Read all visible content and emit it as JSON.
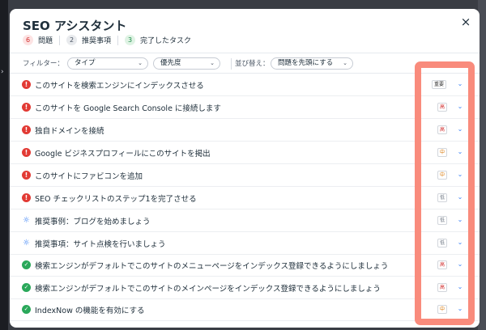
{
  "modal": {
    "title": "SEO アシスタント",
    "close_icon": "×",
    "stats": [
      {
        "count": "6",
        "label": "問題",
        "color": "#d12d2d"
      },
      {
        "count": "2",
        "label": "推奨事項",
        "color": "#4a5563"
      },
      {
        "count": "3",
        "label": "完了したタスク",
        "color": "#1e8c4a"
      }
    ]
  },
  "filters": {
    "filter_label": "フィルター：",
    "type_value": "タイプ",
    "priority_value": "優先度",
    "sort_label": "並び替え：",
    "sort_value": "問題を先頭にする"
  },
  "tasks": [
    {
      "status": "issue",
      "text": "このサイトを検索エンジンにインデックスさせる",
      "priority": "重要"
    },
    {
      "status": "issue",
      "text": "このサイトを Google Search Console に接続します",
      "priority": "高"
    },
    {
      "status": "issue",
      "text": "独自ドメインを接続",
      "priority": "高"
    },
    {
      "status": "issue",
      "text": "Google ビジネスプロフィールにこのサイトを掲出",
      "priority": "中"
    },
    {
      "status": "issue",
      "text": "このサイトにファビコンを追加",
      "priority": "中"
    },
    {
      "status": "issue",
      "text": "SEO チェックリストのステップ1を完了させる",
      "priority": "低"
    },
    {
      "status": "tip",
      "text": "推奨事例：ブログを始めましょう",
      "priority": "低"
    },
    {
      "status": "tip",
      "text": "推奨事項：サイト点検を行いましょう",
      "priority": "低"
    },
    {
      "status": "done",
      "text": "検索エンジンがデフォルトでこのサイトのメニューページをインデックス登録できるようにしましょう",
      "priority": "高"
    },
    {
      "status": "done",
      "text": "検索エンジンがデフォルトでこのサイトのメインページをインデックス登録できるようにしましょう",
      "priority": "高"
    },
    {
      "status": "done",
      "text": "IndexNow の機能を有効にする",
      "priority": "中"
    }
  ],
  "colors": {
    "issue": "#e23a34",
    "done": "#2aa85a",
    "tip": "#3b82f6",
    "highlight": "#f98b7c"
  }
}
